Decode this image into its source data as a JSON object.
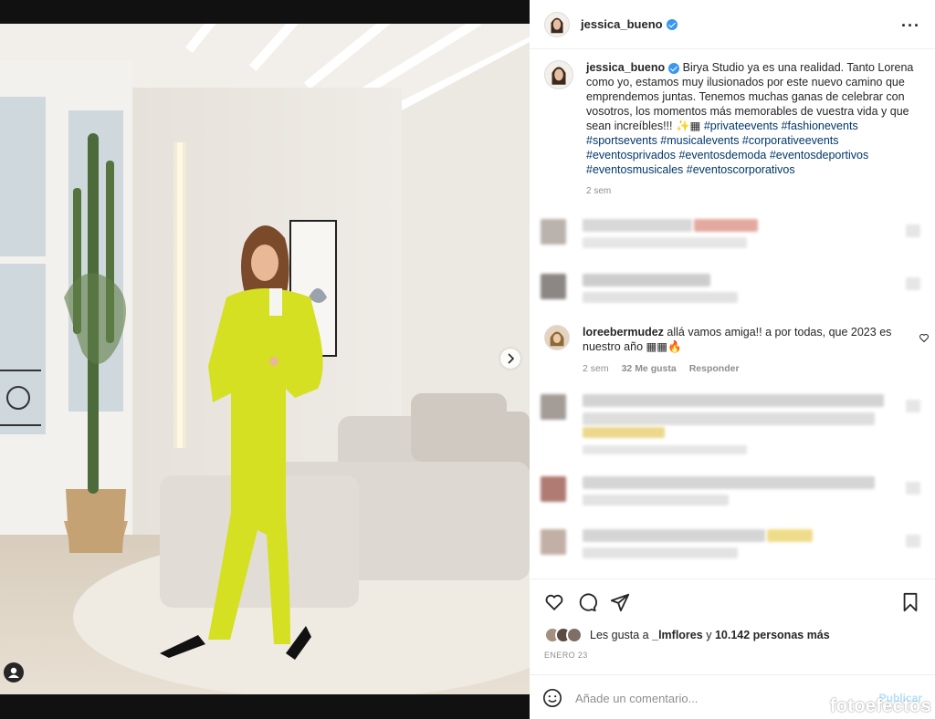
{
  "post": {
    "author": "jessica_bueno",
    "verified": true,
    "caption_text": "Birya Studio ya es una realidad. Tanto Lorena como yo, estamos muy ilusionados por este nuevo camino que emprendemos juntas. Tenemos muchas ganas de celebrar con vosotros, los momentos más memorables de vuestra vida y que sean increíbles!!! ✨▦",
    "hashtags": "#privateevents #fashionevents #sportsevents #musicalevents #corporativeevents #eventosprivados #eventosdemoda #eventosdeportivos #eventosmusicales #eventoscorporativos",
    "caption_time": "2 sem",
    "likes_prefix": "Les gusta a",
    "likes_user": "_lmflores",
    "likes_joiner": "y",
    "likes_count": "10.142 personas más",
    "date": "ENERO 23",
    "image_pages": 2,
    "current_image": 1
  },
  "comment": {
    "user": "loreebermudez",
    "text": "allá vamos amiga!! a por todas, que 2023 es nuestro año ▦▦🔥",
    "time": "2 sem",
    "likes": "32 Me gusta",
    "reply": "Responder"
  },
  "composer": {
    "placeholder": "Añade un comentario...",
    "publish": "Publicar"
  },
  "watermark": "fotoefectos",
  "icons": {
    "more": "more-options-icon",
    "like": "heart-icon",
    "comment": "comment-icon",
    "share": "share-icon",
    "save": "bookmark-icon",
    "emoji": "emoji-icon",
    "next": "chevron-right-icon"
  },
  "colors": {
    "verified": "#3897f0",
    "hashtag": "#00376b",
    "publish_disabled": "#b2dffc",
    "suit": "#d4e021"
  }
}
